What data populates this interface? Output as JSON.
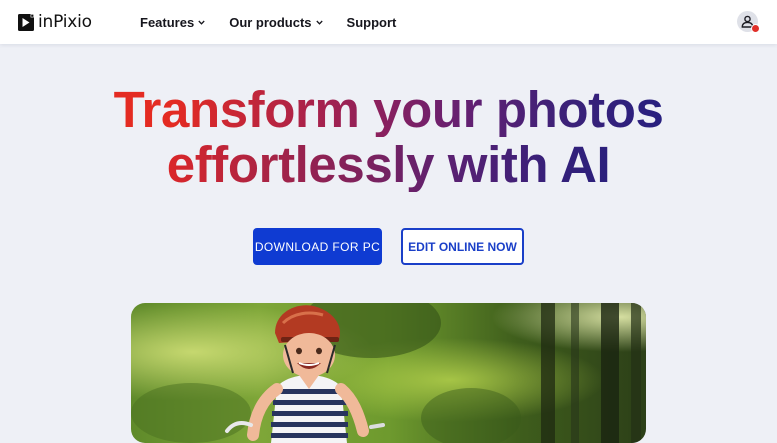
{
  "brand": {
    "name": "inPixio",
    "logo_icon": "play-icon"
  },
  "nav": {
    "items": [
      {
        "label": "Features",
        "has_dropdown": true
      },
      {
        "label": "Our products",
        "has_dropdown": true
      },
      {
        "label": "Support",
        "has_dropdown": false
      }
    ]
  },
  "account": {
    "icon": "user-icon",
    "notification_color": "#e0302a"
  },
  "hero": {
    "headline_line1": "Transform your photos",
    "headline_line2": "effortlessly with AI",
    "gradient_colors": [
      "#e42b22",
      "#6a2070",
      "#28207f"
    ],
    "primary_button": "DOWNLOAD FOR PC",
    "secondary_button": "EDIT ONLINE NOW",
    "primary_color": "#0f3bd2",
    "image_subject": "smiling child in a helmet riding a bike in a sunny forest"
  }
}
